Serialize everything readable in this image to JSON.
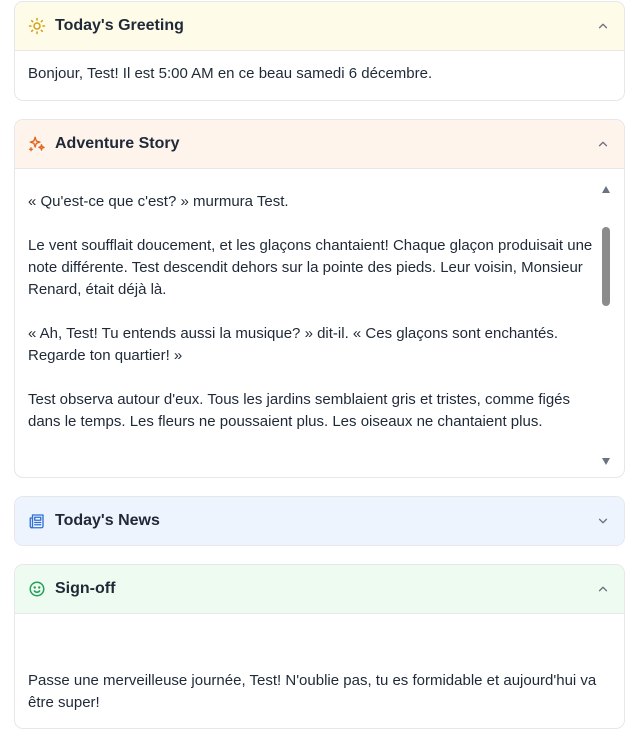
{
  "greeting": {
    "title": "Today's Greeting",
    "icon": "sun-icon",
    "expanded": true,
    "text": "Bonjour, Test! Il est 5:00 AM en ce beau samedi 6 décembre."
  },
  "adventure": {
    "title": "Adventure Story",
    "icon": "sparkles-icon",
    "expanded": true,
    "paragraphs": [
      "« Qu'est-ce que c'est? » murmura Test.",
      "Le vent soufflait doucement, et les glaçons chantaient! Chaque glaçon produisait une note différente. Test descendit dehors sur la pointe des pieds. Leur voisin, Monsieur Renard, était déjà là.",
      "« Ah, Test! Tu entends aussi la musique? » dit-il. « Ces glaçons sont enchantés. Regarde ton quartier! »",
      "Test observa autour d'eux. Tous les jardins semblaient gris et tristes, comme figés dans le temps. Les fleurs ne poussaient plus. Les oiseaux ne chantaient plus."
    ]
  },
  "news": {
    "title": "Today's News",
    "icon": "newspaper-icon",
    "expanded": false
  },
  "signoff": {
    "title": "Sign-off",
    "icon": "smile-icon",
    "expanded": true,
    "text": "Passe une merveilleuse journée, Test! N'oublie pas, tu es formidable et aujourd'hui va être super!"
  },
  "colors": {
    "greeting_header": "#fefbe8",
    "greeting_icon": "#d4a017",
    "adventure_header": "#fef4ec",
    "adventure_icon": "#e0661f",
    "news_header": "#eef4fd",
    "news_icon": "#2f6fd6",
    "signoff_header": "#edfbf1",
    "signoff_icon": "#22a055"
  }
}
